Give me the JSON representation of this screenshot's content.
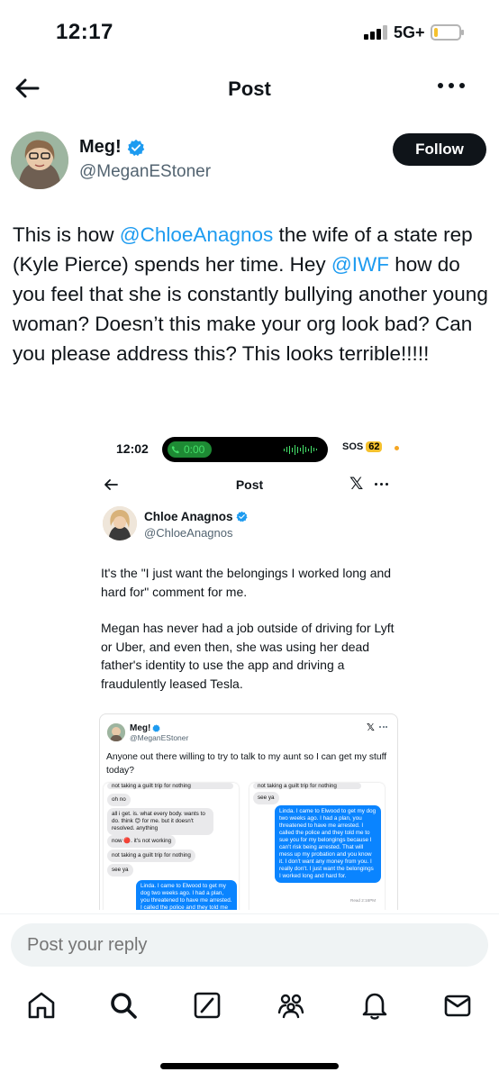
{
  "status_bar": {
    "time": "12:17",
    "network": "5G+",
    "battery_level": 0.15,
    "signal_bars": 3
  },
  "nav": {
    "title": "Post"
  },
  "post": {
    "author_name": "Meg!",
    "author_handle": "@MeganEStoner",
    "follow_label": "Follow",
    "text": {
      "p1": "This is how ",
      "mention1": "@ChloeAnagnos",
      "p2": " the wife of a state rep (Kyle Pierce) spends her time. Hey ",
      "mention2": "@IWF",
      "p3": " how do you feel that she is constantly bullying another young woman? Doesn’t this make your org look bad? Can you please address this? This looks terrible!!!!!"
    }
  },
  "embedded_screenshot": {
    "time": "12:02",
    "call_timer": "0:00",
    "sos_label": "SOS",
    "battery": "62",
    "nav_title": "Post",
    "author_name": "Chloe Anagnos",
    "author_handle": "@ChloeAnagnos",
    "paragraph1": "It's the \"I just want the belongings I worked long and hard for\" comment for me.",
    "paragraph2": "Megan has never had a job outside of driving for Lyft or Uber, and even then, she was using her dead father's identity to use the app and driving a fraudulently leased Tesla.",
    "quoted_post": {
      "author_name": "Meg!",
      "author_handle": "@MeganEStoner",
      "text": "Anyone out there willing to try to talk to my aunt so I can get my stuff today?",
      "thread_left": {
        "top_cut": "not taking a guilt trip for nothing",
        "m1": "oh no",
        "m2": "all i get. is. what every body. wants to do. think 😊 for me. but it doesn't resolved. anything",
        "m3": "now 🔴. it's not working",
        "m4": "not taking a guilt trip for nothing",
        "m5": "see ya",
        "m6": "Linda. I came to Elwood to get my dog two weeks ago. I had a plan, you threatened to have me arrested. I called the police and they told me to sue you for my"
      },
      "thread_right": {
        "top_cut": "not taking a guilt trip for nothing",
        "m1": "see ya",
        "m2": "Linda. I came to Elwood to get my dog two weeks ago. I had a plan, you threatened to have me arrested. I called the police and they told me to sue you for my belongings because I can't risk being arrested. That will mess up my probation and you know it. I don't want any money from you. I really don't. I just want the belongings I worked long and hard for.",
        "read": "Read 2:16PM"
      }
    }
  },
  "reply": {
    "placeholder": "Post your reply"
  },
  "tabs": [
    {
      "icon": "home-icon"
    },
    {
      "icon": "search-icon"
    },
    {
      "icon": "grok-icon"
    },
    {
      "icon": "communities-icon"
    },
    {
      "icon": "notifications-icon"
    },
    {
      "icon": "messages-icon"
    }
  ],
  "colors": {
    "accent": "#1d9bf0",
    "text": "#0f1419",
    "secondary": "#536471",
    "follow_bg": "#0f1419"
  }
}
